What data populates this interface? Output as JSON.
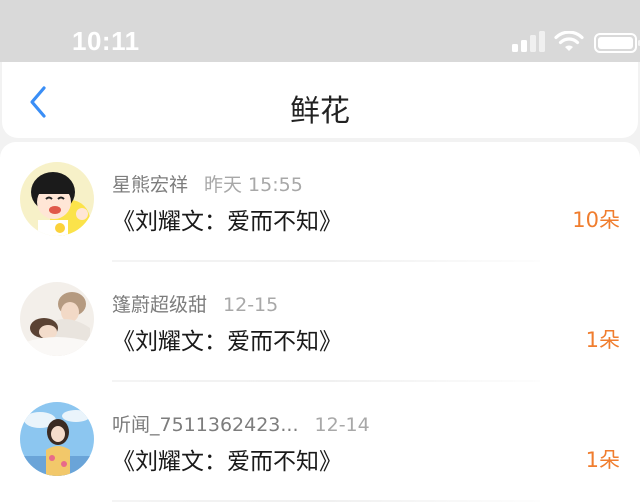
{
  "status_bar": {
    "time": "10:11",
    "icons": [
      "signal-icon",
      "wifi-icon",
      "battery-icon"
    ]
  },
  "nav": {
    "back_icon": "chevron-left-icon",
    "title": "鲜花"
  },
  "items": [
    {
      "user": "星熊宏祥",
      "time": "昨天 15:55",
      "book": "《刘耀文：爱而不知》",
      "count": "10朵",
      "avatar": "cartoon-girl-avatar"
    },
    {
      "user": "篷蔚超级甜",
      "time": "12-15",
      "book": "《刘耀文：爱而不知》",
      "count": "1朵",
      "avatar": "couple-photo-avatar"
    },
    {
      "user": "听闻_7511362423...",
      "time": "12-14",
      "book": "《刘耀文：爱而不知》",
      "count": "1朵",
      "avatar": "girl-photo-avatar"
    }
  ],
  "colors": {
    "accent_blue": "#3a8ef6",
    "count_orange": "#f07d2e",
    "status_bar_bg": "#d9d9d9"
  }
}
